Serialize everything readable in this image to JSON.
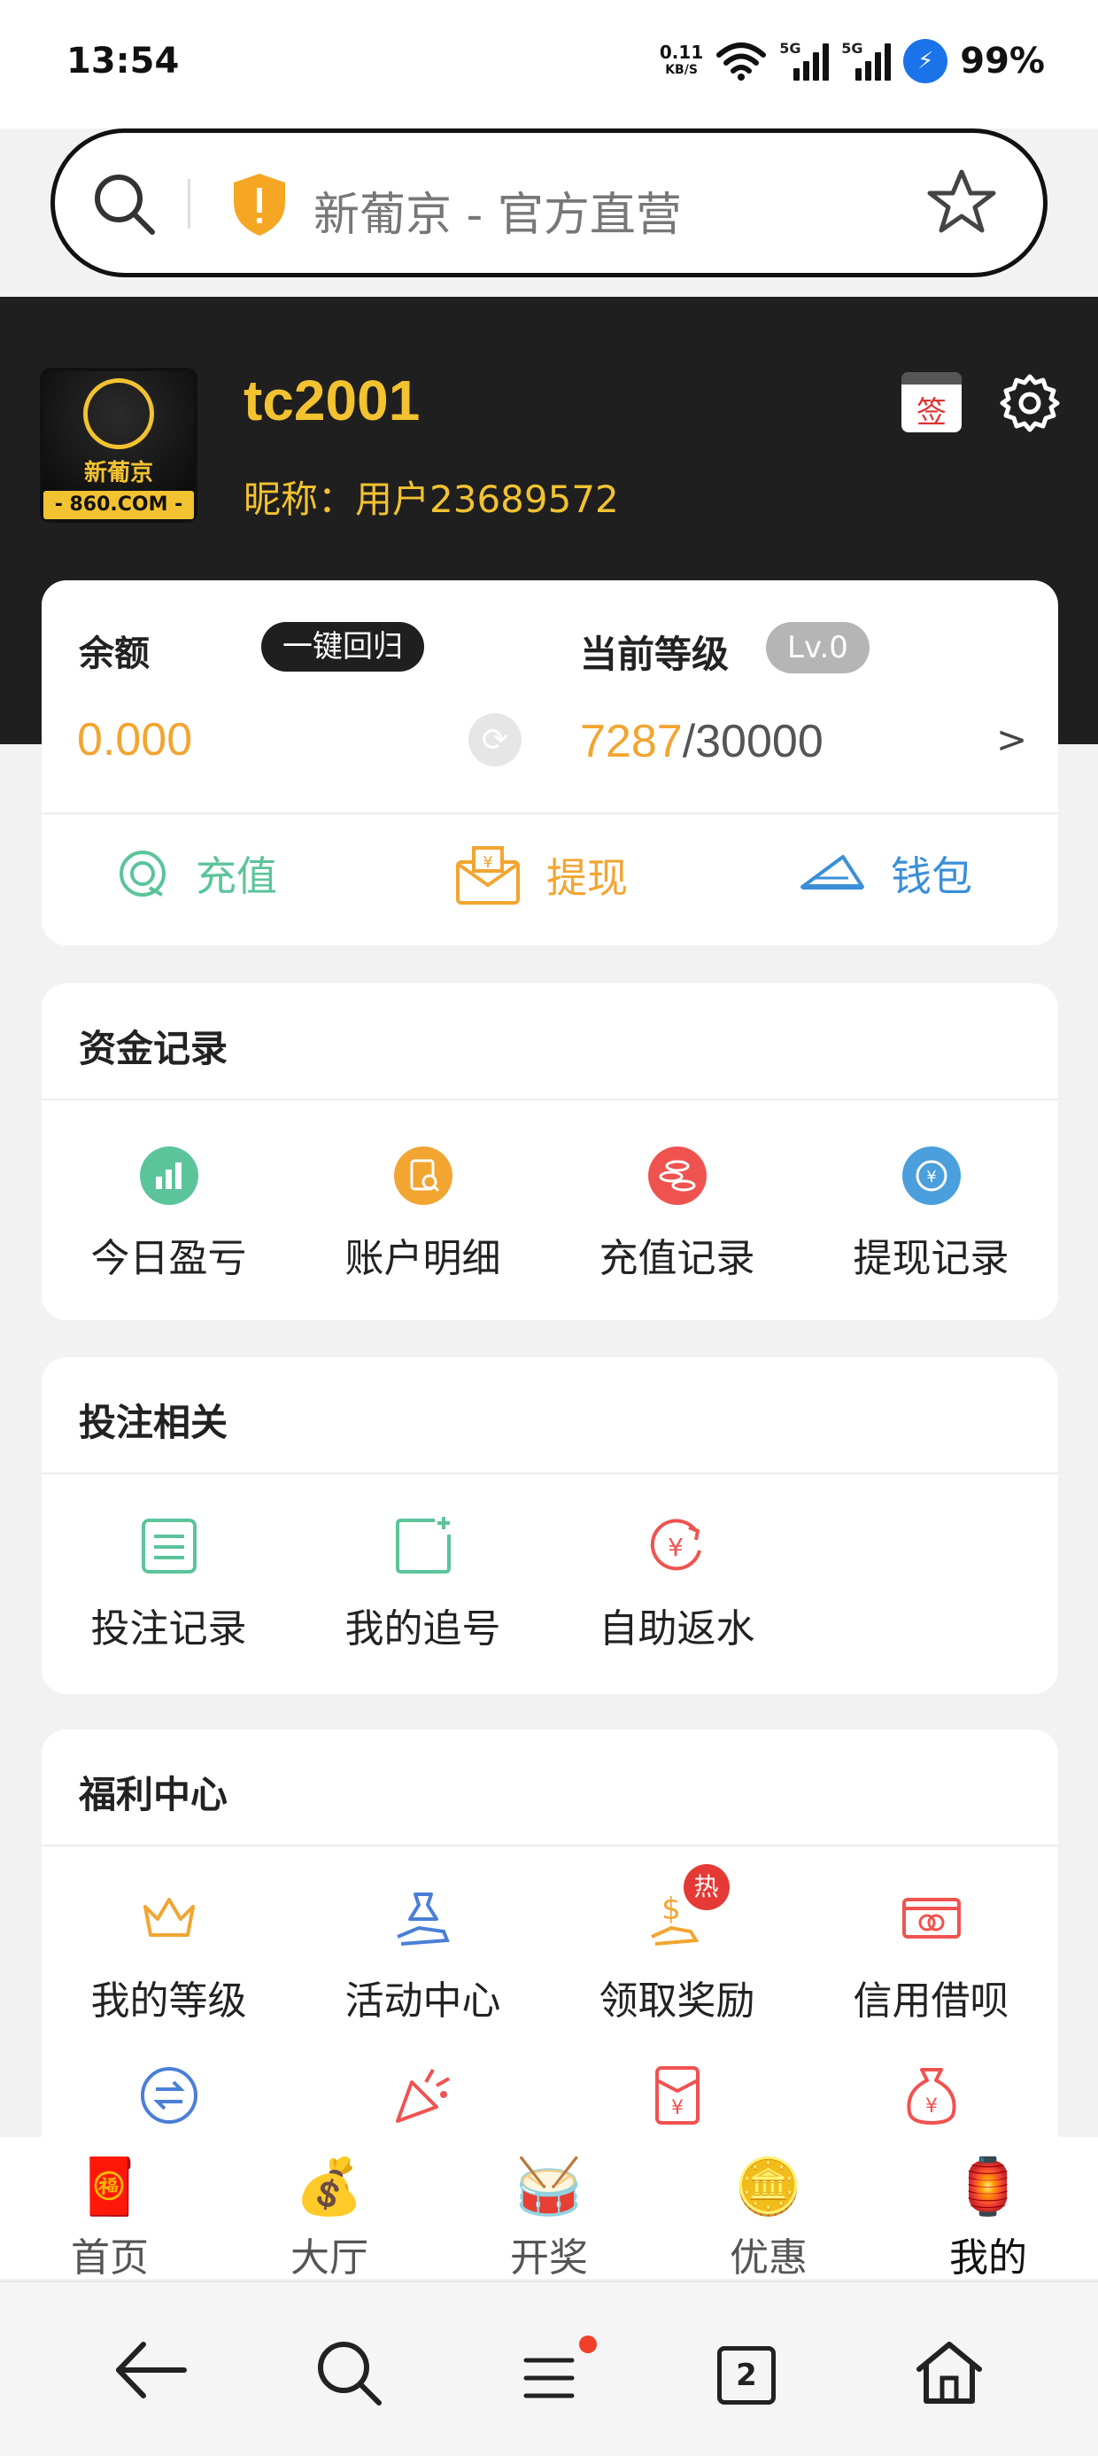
{
  "status_bar": {
    "time": "13:54",
    "net_speed_value": "0.11",
    "net_speed_unit": "KB/S",
    "network_1": "5G",
    "network_2": "5G",
    "battery": "99%"
  },
  "search": {
    "text": "新葡京 - 官方直营"
  },
  "profile": {
    "logo_text": "新葡京",
    "logo_url": "- 860.COM -",
    "username": "tc2001",
    "nickname": "昵称：用户23689572",
    "checkin_label": "签"
  },
  "balance_card": {
    "balance_label": "余额",
    "recall_button": "一键回归",
    "balance_value": "0.000",
    "level_label": "当前等级",
    "level_badge": "Lv.0",
    "level_current": "7287",
    "level_target": "/30000",
    "arrow": ">",
    "actions": [
      {
        "label": "充值",
        "icon": "recharge-icon",
        "color": "#5cc49a"
      },
      {
        "label": "提现",
        "icon": "withdraw-icon",
        "color": "#f2a531"
      },
      {
        "label": "钱包",
        "icon": "wallet-icon",
        "color": "#3a8fd8"
      }
    ]
  },
  "funds_section": {
    "title": "资金记录",
    "items": [
      {
        "label": "今日盈亏",
        "icon": "chart-icon",
        "color": "#5cc49a"
      },
      {
        "label": "账户明细",
        "icon": "document-search-icon",
        "color": "#f2a531"
      },
      {
        "label": "充值记录",
        "icon": "coins-icon",
        "color": "#ef5350"
      },
      {
        "label": "提现记录",
        "icon": "yuan-cycle-icon",
        "color": "#4a9fdc"
      }
    ]
  },
  "betting_section": {
    "title": "投注相关",
    "items": [
      {
        "label": "投注记录",
        "icon": "list-icon"
      },
      {
        "label": "我的追号",
        "icon": "add-track-icon"
      },
      {
        "label": "自助返水",
        "icon": "yuan-refund-icon"
      }
    ]
  },
  "welfare_section": {
    "title": "福利中心",
    "items": [
      {
        "label": "我的等级",
        "icon": "crown-icon"
      },
      {
        "label": "活动中心",
        "icon": "gift-hand-icon"
      },
      {
        "label": "领取奖励",
        "icon": "reward-icon",
        "badge": "热"
      },
      {
        "label": "信用借呗",
        "icon": "credit-card-icon"
      }
    ],
    "row2_icons": [
      "transfer-icon",
      "party-popper-icon",
      "red-envelope-icon",
      "money-bag-icon"
    ]
  },
  "tabs": [
    {
      "label": "首页",
      "emoji": "🧧"
    },
    {
      "label": "大厅",
      "emoji": "💰"
    },
    {
      "label": "开奖",
      "emoji": "🥁"
    },
    {
      "label": "优惠",
      "emoji": "🪙"
    },
    {
      "label": "我的",
      "emoji": "🏮"
    }
  ],
  "browser_nav": {
    "tab_count": "2"
  }
}
